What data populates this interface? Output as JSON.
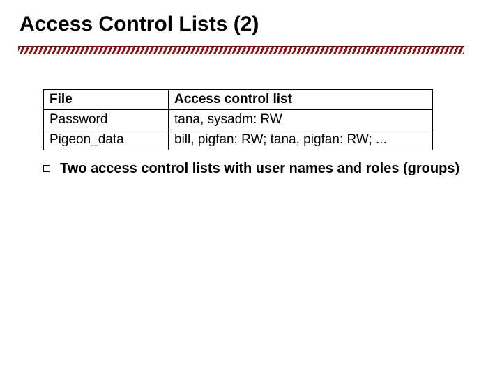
{
  "title": "Access Control Lists (2)",
  "table": {
    "headers": {
      "file": "File",
      "acl": "Access control list"
    },
    "rows": [
      {
        "file": "Password",
        "acl": "tana, sysadm: RW"
      },
      {
        "file": "Pigeon_data",
        "acl": "bill, pigfan: RW;  tana, pigfan: RW; ..."
      }
    ]
  },
  "bullets": [
    "Two access control lists with user names and roles (groups)"
  ]
}
